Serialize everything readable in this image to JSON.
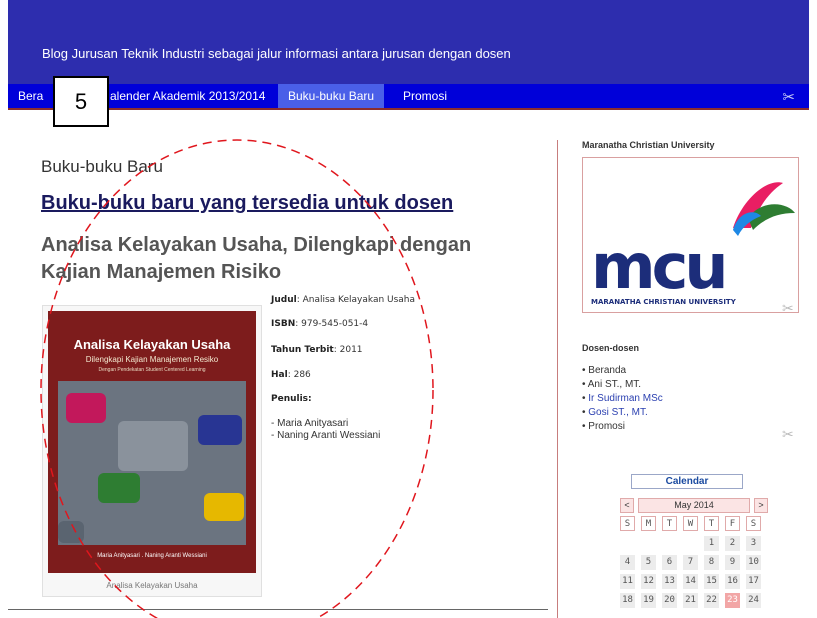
{
  "header": {
    "description": "Blog Jurusan Teknik Industri sebagai jalur informasi antara jurusan dengan dosen"
  },
  "nav": {
    "items": [
      "Bera",
      "alender Akademik 2013/2014",
      "Buku-buku Baru",
      "Promosi"
    ],
    "active_index": 2
  },
  "overlay_label": "5",
  "main": {
    "page_title": "Buku-buku Baru",
    "post_title": "Buku-buku baru yang tersedia untuk dosen",
    "book_title_line1": "Analisa Kelayakan Usaha, Dilengkapi dengan",
    "book_title_line2": "Kajian Manajemen Risiko"
  },
  "book_cover": {
    "title": "Analisa Kelayakan Usaha",
    "subtitle": "Dilengkapi Kajian Manajemen Resiko",
    "note": "Dengan Pendekatan Student Centered Learning",
    "authors": "Maria Anityasari . Naning Aranti Wessiani",
    "caption": "Analisa Kelayakan Usaha"
  },
  "info": {
    "judul_label": "Judul",
    "judul_value": ": Analisa Kelayakan Usaha",
    "isbn_label": "ISBN",
    "isbn_value": ": 979-545-051-4",
    "tahun_label": "Tahun Terbit",
    "tahun_value": ": 2011",
    "hal_label": "Hal",
    "hal_value": ": 286",
    "penulis_label": "Penulis:",
    "author1": "- Maria Anityasari",
    "author2": "- Naning Aranti Wessiani"
  },
  "sidebar": {
    "university_title": "Maranatha Christian University",
    "logo_text": "mcu",
    "logo_caption": "MARANATHA CHRISTIAN UNIVERSITY",
    "dosen_title": "Dosen-dosen",
    "dosen_items": [
      {
        "label": "Beranda",
        "link": false
      },
      {
        "label": "Ani ST., MT.",
        "link": false
      },
      {
        "label": "Ir Sudirman MSc",
        "link": true
      },
      {
        "label": "Gosi ST., MT.",
        "link": true
      },
      {
        "label": "Promosi",
        "link": false
      }
    ]
  },
  "calendar": {
    "title": "Calendar",
    "prev": "<",
    "next": ">",
    "month": "May 2014",
    "weekdays": [
      "S",
      "M",
      "T",
      "W",
      "T",
      "F",
      "S"
    ],
    "rows": [
      [
        "",
        "",
        "",
        "",
        "1",
        "2",
        "3"
      ],
      [
        "4",
        "5",
        "6",
        "7",
        "8",
        "9",
        "10"
      ],
      [
        "11",
        "12",
        "13",
        "14",
        "15",
        "16",
        "17"
      ],
      [
        "18",
        "19",
        "20",
        "21",
        "22",
        "23",
        "24"
      ]
    ],
    "today": "23"
  },
  "colors": {
    "header_bg": "#2d2dae",
    "nav_bg": "#0000d9",
    "active_tab": "#4a5fe8",
    "accent_red": "#c77d7d",
    "ellipse_red": "#e0161d"
  },
  "icons": {
    "nav_tools": "tools-icon",
    "sidebar_tools": "tools-icon"
  }
}
